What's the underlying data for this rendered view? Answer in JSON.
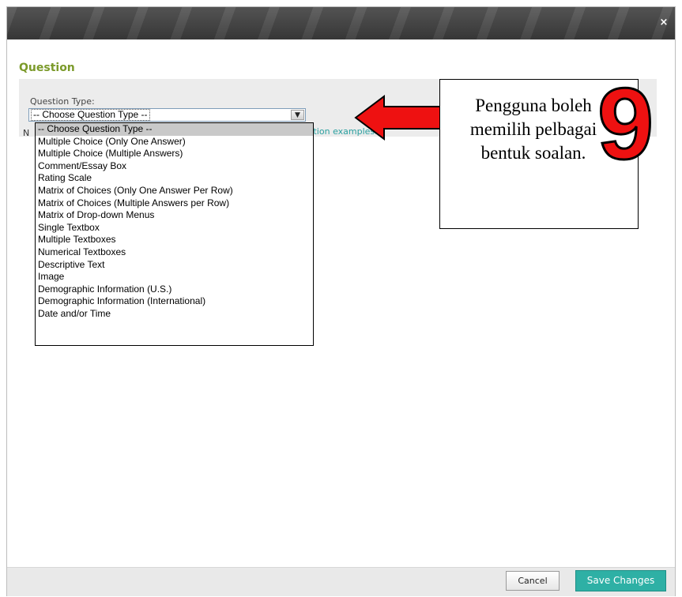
{
  "dialog": {
    "close_glyph": "×",
    "section_title": "Question",
    "question_type_label": "Question Type:",
    "select_value": "-- Choose Question Type --",
    "note_prefix": "N",
    "examples_link": "estion examples."
  },
  "dropdown": {
    "options": [
      "-- Choose Question Type --",
      "Multiple Choice (Only One Answer)",
      "Multiple Choice (Multiple Answers)",
      "Comment/Essay Box",
      "Rating Scale",
      "Matrix of Choices (Only One Answer Per Row)",
      "Matrix of Choices (Multiple Answers per Row)",
      "Matrix of Drop-down Menus",
      "Single Textbox",
      "Multiple Textboxes",
      "Numerical Textboxes",
      "Descriptive Text",
      "Image",
      "Demographic Information (U.S.)",
      "Demographic Information (International)",
      "Date and/or Time"
    ],
    "selected_index": 0
  },
  "footer": {
    "cancel_label": "Cancel",
    "save_label": "Save Changes"
  },
  "annotation": {
    "callout_text": "Pengguna boleh memilih pelbagai bentuk soalan.",
    "step_number": "9",
    "arrow_color": "#ee1111"
  },
  "colors": {
    "accent_green": "#7b9a2a",
    "link_teal": "#2aa0a0",
    "save_button": "#2eb0a5"
  }
}
